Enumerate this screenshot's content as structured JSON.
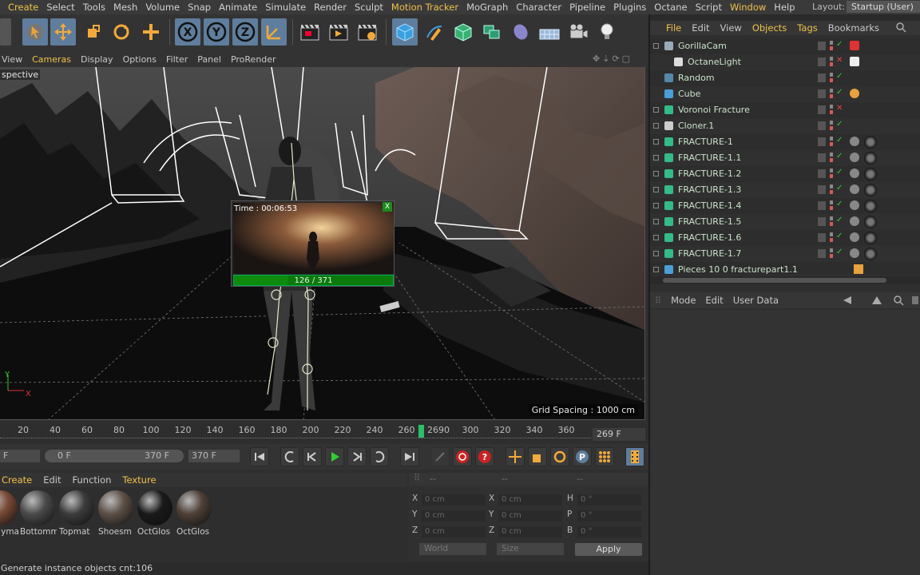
{
  "menubar": {
    "items": [
      {
        "label": "Create",
        "hl": true
      },
      {
        "label": "Select",
        "hl": false
      },
      {
        "label": "Tools",
        "hl": false
      },
      {
        "label": "Mesh",
        "hl": false
      },
      {
        "label": "Volume",
        "hl": false
      },
      {
        "label": "Snap",
        "hl": false
      },
      {
        "label": "Animate",
        "hl": false
      },
      {
        "label": "Simulate",
        "hl": false
      },
      {
        "label": "Render",
        "hl": false
      },
      {
        "label": "Sculpt",
        "hl": false
      },
      {
        "label": "Motion Tracker",
        "hl": true
      },
      {
        "label": "MoGraph",
        "hl": false
      },
      {
        "label": "Character",
        "hl": false
      },
      {
        "label": "Pipeline",
        "hl": false
      },
      {
        "label": "Plugins",
        "hl": false
      },
      {
        "label": "Octane",
        "hl": false
      },
      {
        "label": "Script",
        "hl": false
      },
      {
        "label": "Window",
        "hl": true
      },
      {
        "label": "Help",
        "hl": false
      }
    ],
    "layout_label": "Layout:",
    "layout_value": "Startup (User)"
  },
  "viewport_menu": {
    "items": [
      "View",
      "Cameras",
      "Display",
      "Options",
      "Filter",
      "Panel",
      "ProRender"
    ],
    "highlight_index": 1
  },
  "viewport": {
    "label": "spective",
    "grid_spacing": "Grid Spacing : 1000 cm",
    "axis_y": "Y",
    "axis_x": "X"
  },
  "preview": {
    "title": "Time : 00:06:53",
    "close": "X",
    "progress_text": "126 / 371",
    "progress_fraction": 0.34
  },
  "timeline": {
    "ticks": [
      "20",
      "40",
      "60",
      "80",
      "100",
      "120",
      "140",
      "160",
      "180",
      "200",
      "220",
      "240",
      "260",
      "2690",
      "300",
      "320",
      "340",
      "360"
    ],
    "current_frame": "269 F"
  },
  "playback": {
    "start_field": "F",
    "range_start": "0 F",
    "range_end": "370 F",
    "end_field": "370 F"
  },
  "material_menu": {
    "items": [
      "Create",
      "Edit",
      "Function",
      "Texture"
    ],
    "highlight": [
      0,
      3
    ]
  },
  "materials": [
    {
      "name": "yma",
      "color": "#7a4a35"
    },
    {
      "name": "Bottomm",
      "color": "#4a4a4a"
    },
    {
      "name": "Topmat",
      "color": "#3c3c3c"
    },
    {
      "name": "Shoesm",
      "color": "#5c5046"
    },
    {
      "name": "OctGlos",
      "color": "#1a1a1a"
    },
    {
      "name": "OctGlos",
      "color": "#4e4038"
    }
  ],
  "coords": {
    "header": "--",
    "row_labels": [
      [
        "X",
        "X",
        "H"
      ],
      [
        "Y",
        "Y",
        "P"
      ],
      [
        "Z",
        "Z",
        "B"
      ]
    ],
    "pos_value": "0 cm",
    "rot_value": "0 °",
    "mode1": "World",
    "mode2": "Size",
    "apply": "Apply"
  },
  "statusbar": {
    "text": "Generate instance objects cnt:106"
  },
  "object_manager": {
    "menu": [
      "File",
      "Edit",
      "View",
      "Objects",
      "Tags",
      "Bookmarks"
    ],
    "menu_highlight": [
      0,
      3,
      4
    ],
    "objects": [
      {
        "name": "GorillaCam",
        "indent": 0,
        "icon_color": "#9ab",
        "check": "✓",
        "check_color": "#3c3"
      },
      {
        "name": "OctaneLight",
        "indent": 1,
        "icon_color": "#ddd",
        "check": "✕",
        "check_color": "#d44"
      },
      {
        "name": "Random",
        "indent": 0,
        "icon_color": "#58a",
        "check": "✓",
        "check_color": "#3c3"
      },
      {
        "name": "Cube",
        "indent": 0,
        "icon_color": "#4a9fd8",
        "check": "✓",
        "check_color": "#3c3"
      },
      {
        "name": "Voronoi Fracture",
        "indent": 0,
        "icon_color": "#3b8",
        "check": "✕",
        "check_color": "#d44"
      },
      {
        "name": "Cloner.1",
        "indent": 0,
        "icon_color": "#ccc",
        "check": "✓",
        "check_color": "#3c3"
      },
      {
        "name": "FRACTURE-1",
        "indent": 0,
        "icon_color": "#3b8",
        "check": "✓",
        "check_color": "#3c3"
      },
      {
        "name": "FRACTURE-1.1",
        "indent": 0,
        "icon_color": "#3b8",
        "check": "✓",
        "check_color": "#3c3"
      },
      {
        "name": "FRACTURE-1.2",
        "indent": 0,
        "icon_color": "#3b8",
        "check": "✓",
        "check_color": "#3c3"
      },
      {
        "name": "FRACTURE-1.3",
        "indent": 0,
        "icon_color": "#3b8",
        "check": "✓",
        "check_color": "#3c3"
      },
      {
        "name": "FRACTURE-1.4",
        "indent": 0,
        "icon_color": "#3b8",
        "check": "✓",
        "check_color": "#3c3"
      },
      {
        "name": "FRACTURE-1.5",
        "indent": 0,
        "icon_color": "#3b8",
        "check": "✓",
        "check_color": "#3c3"
      },
      {
        "name": "FRACTURE-1.6",
        "indent": 0,
        "icon_color": "#3b8",
        "check": "✓",
        "check_color": "#3c3"
      },
      {
        "name": "FRACTURE-1.7",
        "indent": 0,
        "icon_color": "#3b8",
        "check": "✓",
        "check_color": "#3c3"
      },
      {
        "name": "Pieces 10 0 fracturepart1.1",
        "indent": 0,
        "icon_color": "#4a9fd8",
        "check": "",
        "check_color": "#3c3"
      }
    ]
  },
  "attribute_manager": {
    "menu": [
      "Mode",
      "Edit",
      "User Data"
    ]
  },
  "colors": {
    "accent": "#f1c24a",
    "selection": "#5f7d9c",
    "progress": "#0e8a0e",
    "object_name": "#c9e2c9"
  }
}
